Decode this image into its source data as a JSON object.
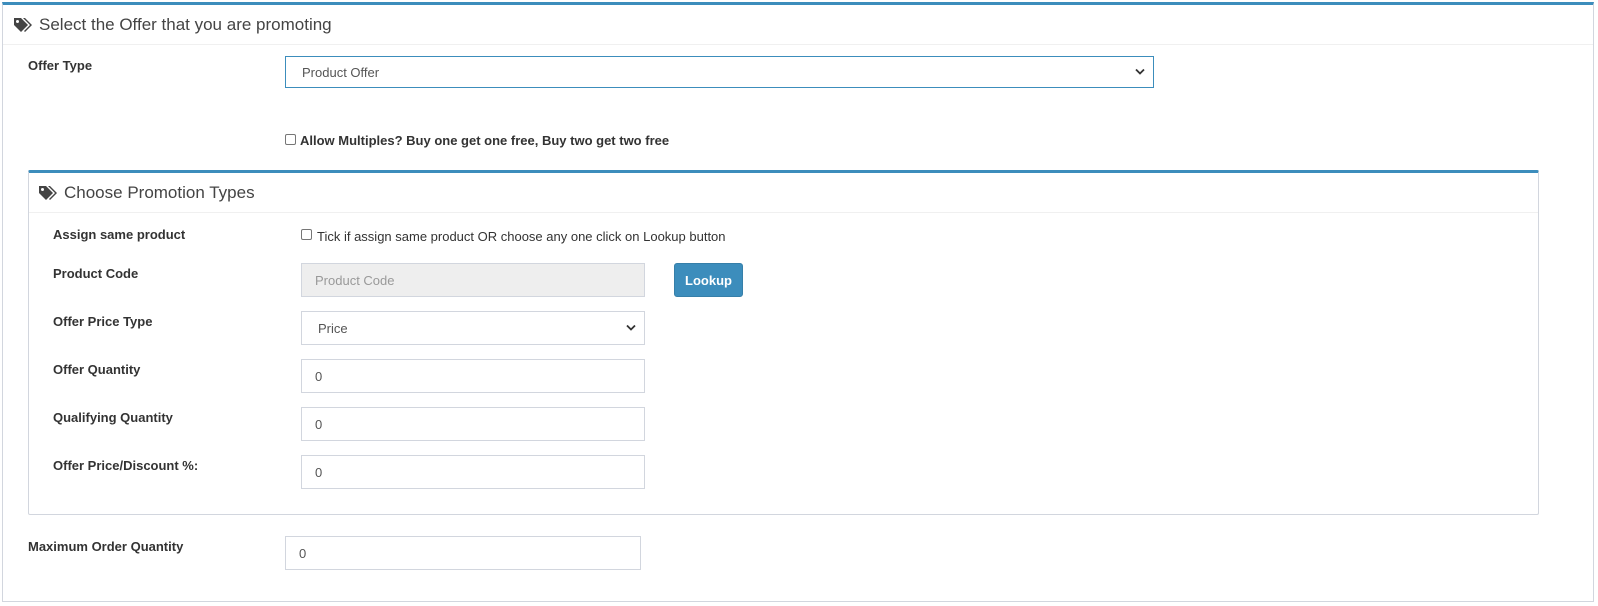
{
  "main_section": {
    "title": "Select the Offer that you are promoting",
    "offer_type_label": "Offer Type",
    "offer_type_value": "Product Offer",
    "allow_multiples_label": "Allow Multiples? Buy one get one free, Buy two get two free",
    "max_order_qty_label": "Maximum Order Quantity",
    "max_order_qty_value": "0"
  },
  "promotion_section": {
    "title": "Choose Promotion Types",
    "assign_same_label": "Assign same product",
    "assign_same_hint": "Tick if assign same product OR choose any one click on Lookup button",
    "product_code_label": "Product Code",
    "product_code_placeholder": "Product Code",
    "lookup_button": "Lookup",
    "offer_price_type_label": "Offer Price Type",
    "offer_price_type_value": "Price",
    "offer_quantity_label": "Offer Quantity",
    "offer_quantity_value": "0",
    "qualifying_quantity_label": "Qualifying Quantity",
    "qualifying_quantity_value": "0",
    "offer_price_discount_label": "Offer Price/Discount %:",
    "offer_price_discount_value": "0"
  },
  "colors": {
    "accent": "#3c8dbc",
    "border": "#d2d6de",
    "readonly_bg": "#eeeeee"
  },
  "icons": {
    "section_icon": "tags-icon",
    "select_icon": "chevron-down-icon"
  }
}
